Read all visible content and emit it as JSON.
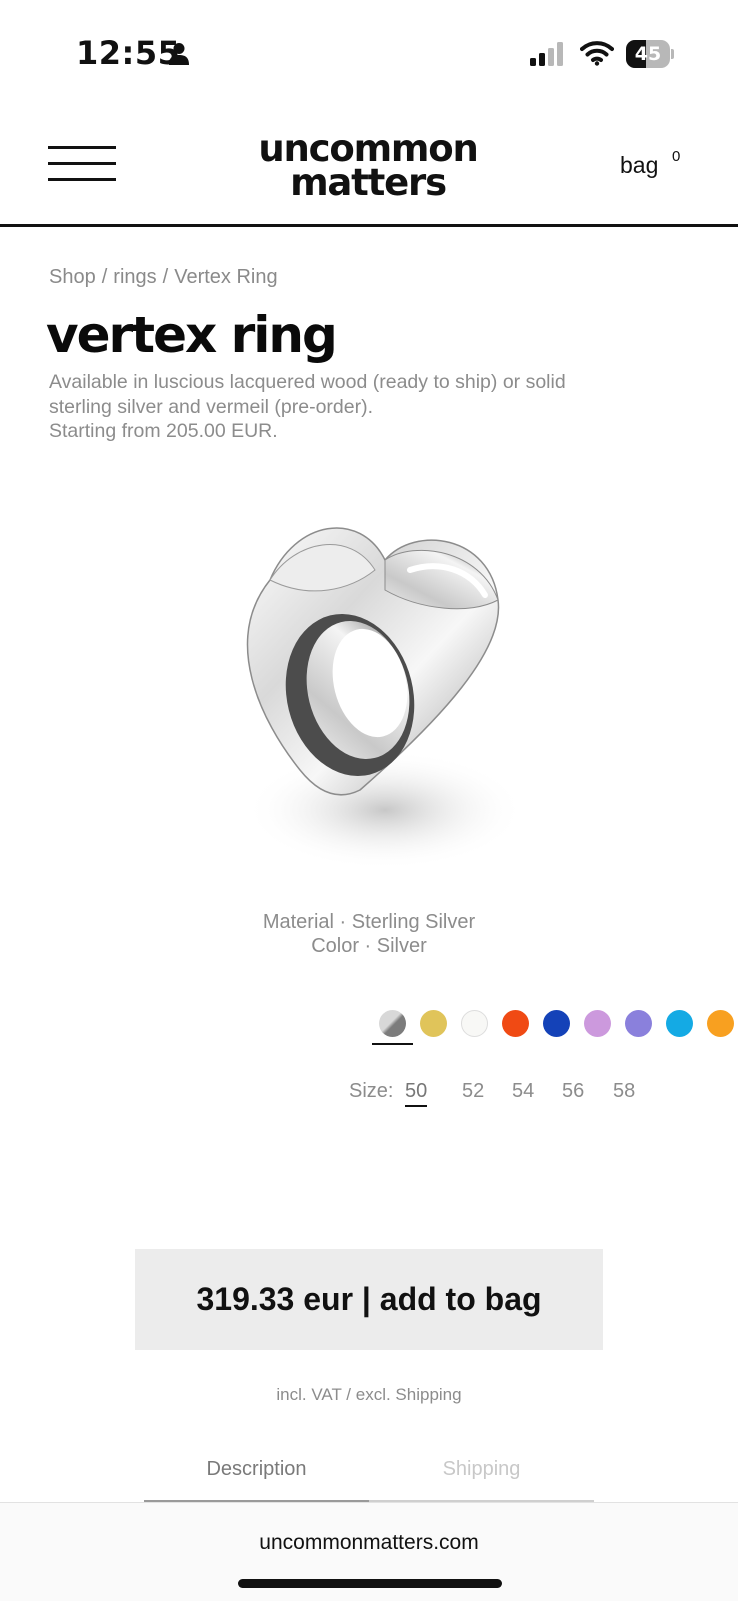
{
  "status_bar": {
    "time": "12:55",
    "battery_level": "45",
    "battery_fraction": 0.45
  },
  "header": {
    "logo_line1": "uncommon",
    "logo_line2": "matters",
    "bag_label": "bag",
    "bag_count": "0"
  },
  "breadcrumb": {
    "items": [
      "Shop",
      "rings",
      "Vertex Ring"
    ],
    "separator": "/"
  },
  "product": {
    "title": "vertex ring",
    "description_lines": [
      "Available in luscious lacquered wood (ready to ship) or solid",
      "sterling silver and vermeil (pre-order).",
      "Starting from 205.00 EUR."
    ],
    "material_line": "Material · Sterling Silver",
    "color_line": "Color · Silver"
  },
  "swatches": [
    {
      "name": "silver",
      "color": "#8f8f8f",
      "selected": true
    },
    {
      "name": "gold",
      "color": "#e0c45a",
      "selected": false
    },
    {
      "name": "white",
      "color": "#f8f8f6",
      "selected": false
    },
    {
      "name": "orange-red",
      "color": "#f04a14",
      "selected": false
    },
    {
      "name": "blue",
      "color": "#1442b8",
      "selected": false
    },
    {
      "name": "lilac",
      "color": "#cc99dd",
      "selected": false
    },
    {
      "name": "lavender",
      "color": "#8a80dc",
      "selected": false
    },
    {
      "name": "sky-blue",
      "color": "#14aae4",
      "selected": false
    },
    {
      "name": "orange",
      "color": "#f8a020",
      "selected": false
    }
  ],
  "sizes": {
    "label": "Size:",
    "options": [
      "50",
      "52",
      "54",
      "56",
      "58"
    ],
    "selected": "50"
  },
  "cta": {
    "label": "319.33 eur | add to bag"
  },
  "vat_note": "incl. VAT / excl. Shipping",
  "tabs": [
    {
      "label": "Description",
      "active": true
    },
    {
      "label": "Shipping",
      "active": false
    }
  ],
  "browser": {
    "url": "uncommonmatters.com"
  },
  "colors": {
    "accent": "#111111",
    "muted_text": "#8c8c8c",
    "cta_background": "#ececec"
  }
}
